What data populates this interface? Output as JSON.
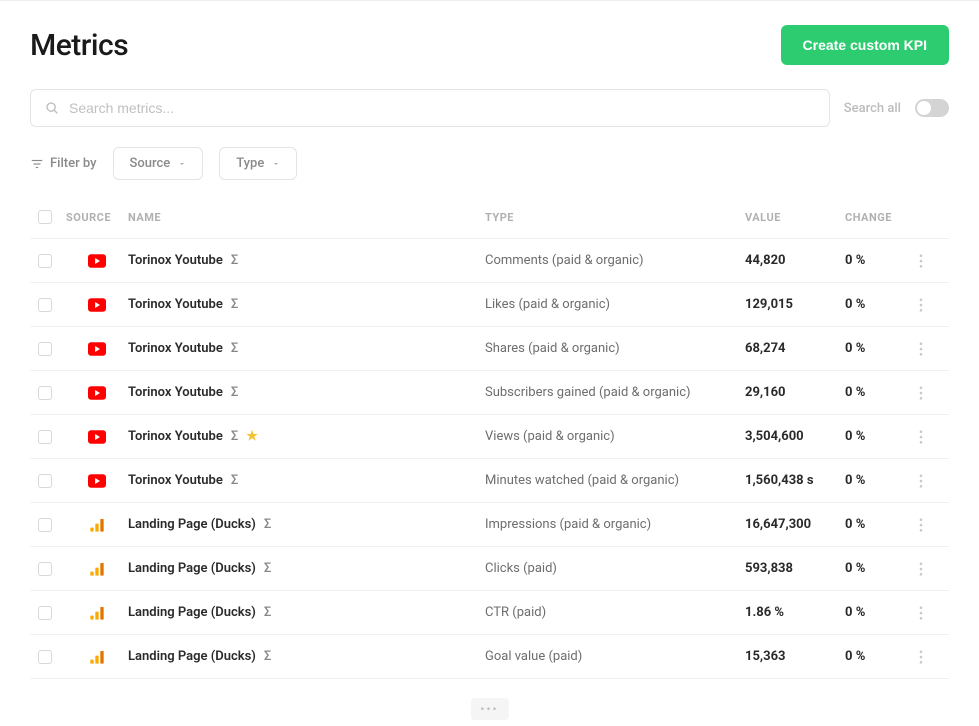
{
  "header": {
    "title": "Metrics",
    "create_button": "Create custom KPI"
  },
  "search": {
    "placeholder": "Search metrics...",
    "search_all_label": "Search all"
  },
  "filters": {
    "filter_by_label": "Filter by",
    "source_label": "Source",
    "type_label": "Type"
  },
  "table": {
    "columns": {
      "source": "SOURCE",
      "name": "NAME",
      "type": "TYPE",
      "value": "VALUE",
      "change": "CHANGE"
    },
    "rows": [
      {
        "source_icon": "youtube",
        "name": "Torinox Youtube",
        "starred": false,
        "type": "Comments (paid & organic)",
        "value": "44,820",
        "change": "0 %"
      },
      {
        "source_icon": "youtube",
        "name": "Torinox Youtube",
        "starred": false,
        "type": "Likes (paid & organic)",
        "value": "129,015",
        "change": "0 %"
      },
      {
        "source_icon": "youtube",
        "name": "Torinox Youtube",
        "starred": false,
        "type": "Shares (paid & organic)",
        "value": "68,274",
        "change": "0 %"
      },
      {
        "source_icon": "youtube",
        "name": "Torinox Youtube",
        "starred": false,
        "type": "Subscribers gained (paid & organic)",
        "value": "29,160",
        "change": "0 %"
      },
      {
        "source_icon": "youtube",
        "name": "Torinox Youtube",
        "starred": true,
        "type": "Views (paid & organic)",
        "value": "3,504,600",
        "change": "0 %"
      },
      {
        "source_icon": "youtube",
        "name": "Torinox Youtube",
        "starred": false,
        "type": "Minutes watched (paid & organic)",
        "value": "1,560,438 s",
        "change": "0 %"
      },
      {
        "source_icon": "analytics",
        "name": "Landing Page (Ducks)",
        "starred": false,
        "type": "Impressions (paid & organic)",
        "value": "16,647,300",
        "change": "0 %"
      },
      {
        "source_icon": "analytics",
        "name": "Landing Page (Ducks)",
        "starred": false,
        "type": "Clicks (paid)",
        "value": "593,838",
        "change": "0 %"
      },
      {
        "source_icon": "analytics",
        "name": "Landing Page (Ducks)",
        "starred": false,
        "type": "CTR (paid)",
        "value": "1.86 %",
        "change": "0 %"
      },
      {
        "source_icon": "analytics",
        "name": "Landing Page (Ducks)",
        "starred": false,
        "type": "Goal value (paid)",
        "value": "15,363",
        "change": "0 %"
      }
    ]
  }
}
